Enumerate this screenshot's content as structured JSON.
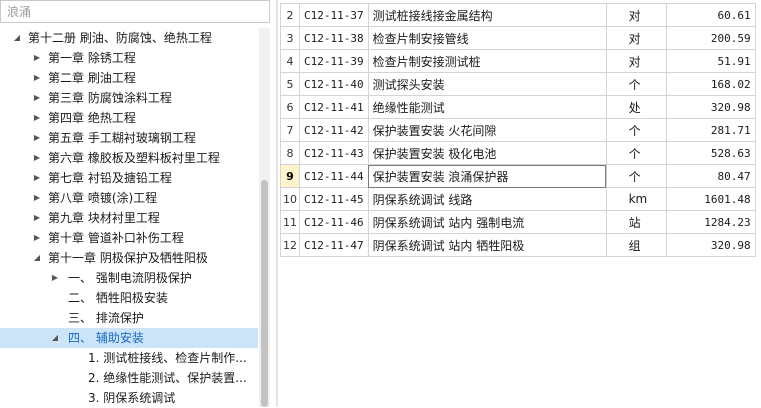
{
  "search": {
    "placeholder": "浪涌"
  },
  "tree": [
    {
      "label": "第十二册 刷油、防腐蚀、绝热工程",
      "indent": 28,
      "tog": "◢",
      "togx": 12,
      "sel": false
    },
    {
      "label": "第一章 除锈工程",
      "indent": 48,
      "tog": "▶",
      "togx": 32,
      "sel": false
    },
    {
      "label": "第二章 刷油工程",
      "indent": 48,
      "tog": "▶",
      "togx": 32,
      "sel": false
    },
    {
      "label": "第三章 防腐蚀涂料工程",
      "indent": 48,
      "tog": "▶",
      "togx": 32,
      "sel": false
    },
    {
      "label": "第四章 绝热工程",
      "indent": 48,
      "tog": "▶",
      "togx": 32,
      "sel": false
    },
    {
      "label": "第五章 手工糊衬玻璃钢工程",
      "indent": 48,
      "tog": "▶",
      "togx": 32,
      "sel": false
    },
    {
      "label": "第六章 橡胶板及塑料板衬里工程",
      "indent": 48,
      "tog": "▶",
      "togx": 32,
      "sel": false
    },
    {
      "label": "第七章 衬铅及搪铅工程",
      "indent": 48,
      "tog": "▶",
      "togx": 32,
      "sel": false
    },
    {
      "label": "第八章 喷镀(涂)工程",
      "indent": 48,
      "tog": "▶",
      "togx": 32,
      "sel": false
    },
    {
      "label": "第九章 块材衬里工程",
      "indent": 48,
      "tog": "▶",
      "togx": 32,
      "sel": false
    },
    {
      "label": "第十章 管道补口补伤工程",
      "indent": 48,
      "tog": "▶",
      "togx": 32,
      "sel": false
    },
    {
      "label": "第十一章 阴极保护及牺牲阳极",
      "indent": 48,
      "tog": "◢",
      "togx": 32,
      "sel": false
    },
    {
      "label": "一、 强制电流阴极保护",
      "indent": 68,
      "tog": "▶",
      "togx": 50,
      "sel": false
    },
    {
      "label": "二、 牺牲阳极安装",
      "indent": 68,
      "tog": "",
      "togx": 50,
      "sel": false
    },
    {
      "label": "三、 排流保护",
      "indent": 68,
      "tog": "",
      "togx": 50,
      "sel": false
    },
    {
      "label": "四、 辅助安装",
      "indent": 68,
      "tog": "◢",
      "togx": 50,
      "sel": true
    },
    {
      "label": "1. 测试桩接线、检查片制作...",
      "indent": 88,
      "tog": "",
      "togx": 70,
      "sel": false
    },
    {
      "label": "2. 绝缘性能测试、保护装置...",
      "indent": 88,
      "tog": "",
      "togx": 70,
      "sel": false
    },
    {
      "label": "3. 阴保系统调试",
      "indent": 88,
      "tog": "",
      "togx": 70,
      "sel": false
    }
  ],
  "rows": [
    {
      "num": "2",
      "code": "C12-11-37",
      "name": "测试桩接线接金属结构",
      "unit": "对",
      "price": "60.61",
      "cur": false
    },
    {
      "num": "3",
      "code": "C12-11-38",
      "name": "检查片制安接管线",
      "unit": "对",
      "price": "200.59",
      "cur": false
    },
    {
      "num": "4",
      "code": "C12-11-39",
      "name": "检查片制安接测试桩",
      "unit": "对",
      "price": "51.91",
      "cur": false
    },
    {
      "num": "5",
      "code": "C12-11-40",
      "name": "测试探头安装",
      "unit": "个",
      "price": "168.02",
      "cur": false
    },
    {
      "num": "6",
      "code": "C12-11-41",
      "name": "绝缘性能测试",
      "unit": "处",
      "price": "320.98",
      "cur": false
    },
    {
      "num": "7",
      "code": "C12-11-42",
      "name": "保护装置安装 火花间隙",
      "unit": "个",
      "price": "281.71",
      "cur": false
    },
    {
      "num": "8",
      "code": "C12-11-43",
      "name": "保护装置安装 极化电池",
      "unit": "个",
      "price": "528.63",
      "cur": false
    },
    {
      "num": "9",
      "code": "C12-11-44",
      "name": "保护装置安装 浪涌保护器",
      "unit": "个",
      "price": "80.47",
      "cur": true
    },
    {
      "num": "10",
      "code": "C12-11-45",
      "name": "阴保系统调试 线路",
      "unit": "km",
      "price": "1601.48",
      "cur": false
    },
    {
      "num": "11",
      "code": "C12-11-46",
      "name": "阴保系统调试 站内 强制电流",
      "unit": "站",
      "price": "1284.23",
      "cur": false
    },
    {
      "num": "12",
      "code": "C12-11-47",
      "name": "阴保系统调试 站内 牺牲阳极",
      "unit": "组",
      "price": "320.98",
      "cur": false
    }
  ]
}
